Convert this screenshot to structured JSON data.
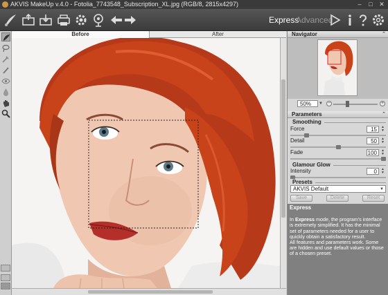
{
  "titlebar": {
    "title": "AKVIS MakeUp v.4.0 - Fotolia_7743548_Subscription_XL.jpg (RGB/8, 2815x4297)",
    "buttons": [
      "–",
      "□",
      "✕"
    ]
  },
  "toolbar": {
    "icons": [
      "logo-brush",
      "open-icon",
      "save-icon",
      "print-icon",
      "settings-gear-icon",
      "preferences-gear-icon",
      "info-pin-icon",
      "undo-arrow-icon",
      "redo-arrow-icon"
    ],
    "express_label": "Express",
    "advanced_label": "Advanced",
    "right_icons": [
      "run-icon",
      "about-icon",
      "help-icon",
      "settings-icon"
    ]
  },
  "tabs": {
    "before": "Before",
    "after": "After",
    "active": "Before"
  },
  "navigator": {
    "title": "Navigator",
    "zoom": "50%"
  },
  "parameters": {
    "title": "Parameters",
    "smoothing_title": "Smoothing",
    "force": {
      "label": "Force",
      "value": "15",
      "level": 0.15
    },
    "detail": {
      "label": "Detail",
      "value": "50",
      "level": 0.5
    },
    "fade": {
      "label": "Fade",
      "value": "100",
      "level": 1.0
    },
    "glow_title": "Glamour Glow",
    "intensity": {
      "label": "Intensity",
      "value": "0",
      "level": 0.0
    }
  },
  "presets": {
    "title": "Presets",
    "selected": "AKVIS Default",
    "save": "Save",
    "delete": "Delete",
    "reset": "Reset"
  },
  "help": {
    "title": "Express",
    "p1_prefix": "In ",
    "p1_bold": "Express",
    "p1_rest": " mode, the program's interface is extremely simplified. It has the minimal set of parameters needed for a user to quickly obtain a satisfactory result.",
    "p2": "All features and parameters work. Some are hidden and use default values or those of a chosen preset."
  },
  "colors": {
    "hair": "#c8421a",
    "toolbar": "#3b3b3b",
    "help_bg": "#808080"
  }
}
